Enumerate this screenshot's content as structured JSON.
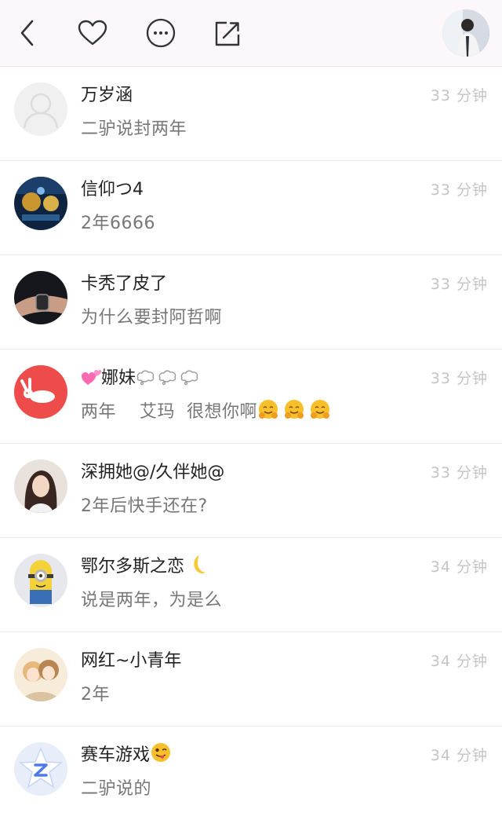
{
  "header": {
    "icons": [
      "back-chevron-icon",
      "heart-icon",
      "more-icon",
      "share-icon"
    ]
  },
  "comments": [
    {
      "name": "万岁涵",
      "message": "二驴说封两年",
      "time": "33 分钟",
      "avatar": "default-person"
    },
    {
      "name": "信仰つ4",
      "message": "2年6666",
      "time": "33 分钟",
      "avatar": "game-scene"
    },
    {
      "name": "卡秃了皮了",
      "message": "为什么要封阿哲啊",
      "time": "33 分钟",
      "avatar": "wristwatch-photo"
    },
    {
      "name": "娜妹",
      "message": "两年    艾玛  很想你啊",
      "time": "33 分钟",
      "avatar": "white-rabbit-on-red"
    },
    {
      "name": "深拥她@/久伴她@",
      "message": "2年后快手还在?",
      "time": "33 分钟",
      "avatar": "woman-portrait"
    },
    {
      "name": "鄂尔多斯之恋",
      "message": "说是两年，为是么",
      "time": "34 分钟",
      "avatar": "minion"
    },
    {
      "name": "网红~小青年",
      "message": "2年",
      "time": "34 分钟",
      "avatar": "anime-couple"
    },
    {
      "name": "赛车游戏",
      "message": "二驴说的",
      "time": "34 分钟",
      "avatar": "app-logo-z"
    }
  ],
  "colors": {
    "header_bg": "#fbf7fa",
    "name": "#222222",
    "message": "#777777",
    "timestamp": "#c4c4c4",
    "divider": "#ebebeb"
  }
}
